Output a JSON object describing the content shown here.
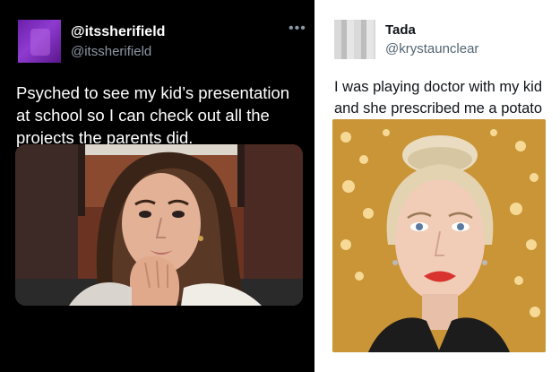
{
  "left_tweet": {
    "display_name": "@itssherifield",
    "handle": "@itssherifield",
    "more_label": "•••",
    "text": "Psyched to see my kid’s presentation at school so I can check out all the projects the parents did.",
    "avatar_icon": "avatar-image",
    "media_icon": "photo-woman-chin-on-hand",
    "theme": {
      "background": "#000000",
      "text": "#ffffff",
      "secondary": "#8b98a5"
    }
  },
  "right_tweet": {
    "display_name": "Tada",
    "handle": "@krystaunclear",
    "text": "I was playing doctor with my kid and she prescribed me a potato",
    "avatar_icon": "avatar-image",
    "media_icon": "photo-woman-blonde-updo",
    "theme": {
      "background": "#ffffff",
      "text": "#0f1419",
      "secondary": "#536471"
    }
  }
}
